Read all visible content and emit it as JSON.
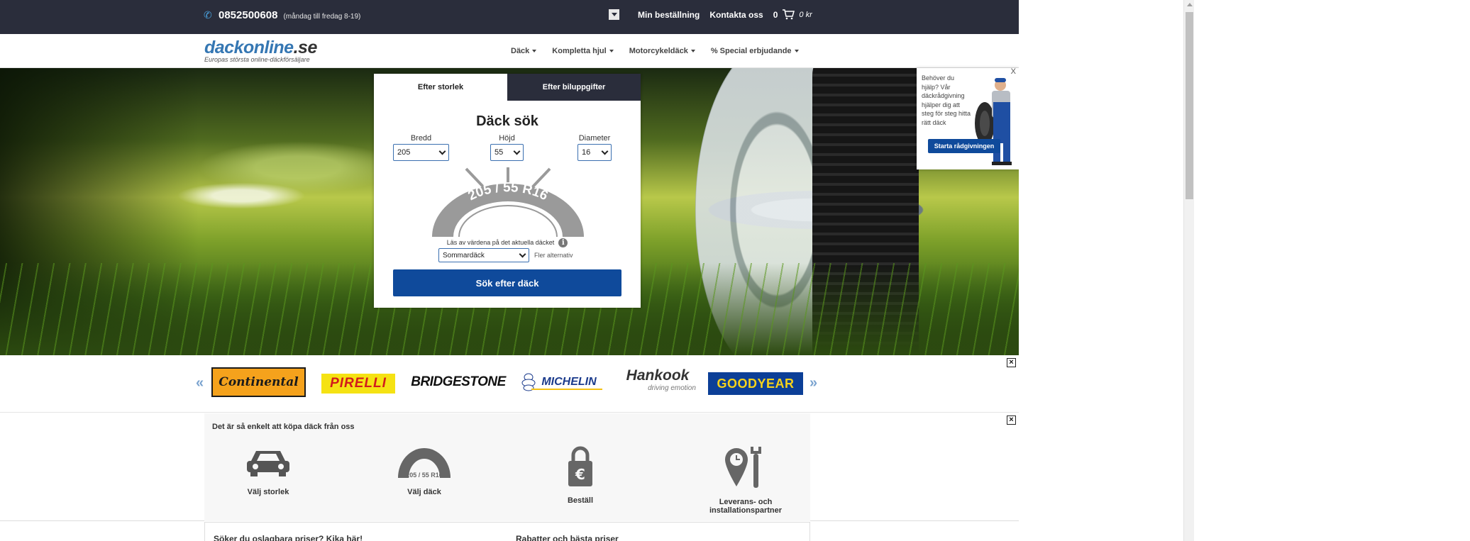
{
  "topbar": {
    "phone": "0852500608",
    "hours": "(måndag till fredag 8-19)",
    "my_order": "Min beställning",
    "contact": "Kontakta oss",
    "cart_count": "0",
    "cart_total": "0 kr"
  },
  "header": {
    "logo_name": "dackonline",
    "logo_tld": ".se",
    "tagline": "Europas största online-däckförsäljare",
    "nav": [
      "Däck",
      "Kompletta hjul",
      "Motorcykeldäck",
      "% Special erbjudande"
    ]
  },
  "search": {
    "tab_size": "Efter storlek",
    "tab_vehicle": "Efter biluppgifter",
    "title": "Däck sök",
    "width_label": "Bredd",
    "width_value": "205",
    "height_label": "Höjd",
    "height_value": "55",
    "diameter_label": "Diameter",
    "diameter_value": "16",
    "gauge_text": "205 / 55 R16",
    "read_hint": "Läs av värdena på det aktuella däcket",
    "season_value": "Sommardäck",
    "more_options": "Fler alternativ",
    "submit_label": "Sök efter däck"
  },
  "help_widget": {
    "close": "X",
    "text": "Behöver du hjälp? Vår däckrådgivning hjälper dig att steg för steg hitta rätt däck",
    "button": "Starta rådgivningen"
  },
  "brands": {
    "prev": "«",
    "next": "»",
    "items": [
      "Continental",
      "PIRELLI",
      "BRIDGESTONE",
      "MICHELIN",
      "Hankook",
      "GOODYEAR"
    ],
    "hankook_slogan": "driving emotion",
    "close": "×"
  },
  "steps": {
    "title": "Det är så enkelt att köpa däck från oss",
    "close": "×",
    "items": [
      "Välj storlek",
      "Välj däck",
      "Beställ",
      "Leverans- och installationspartner"
    ],
    "tire_label": "205 / 55 R16"
  },
  "bottom": {
    "left_heading": "Söker du oslagbara priser? Kika här!",
    "right_heading": "Rabatter och bästa priser"
  },
  "colors": {
    "topbar": "#2a2d3b",
    "accent_blue": "#0f4a9b",
    "logo_blue": "#3577b3"
  }
}
